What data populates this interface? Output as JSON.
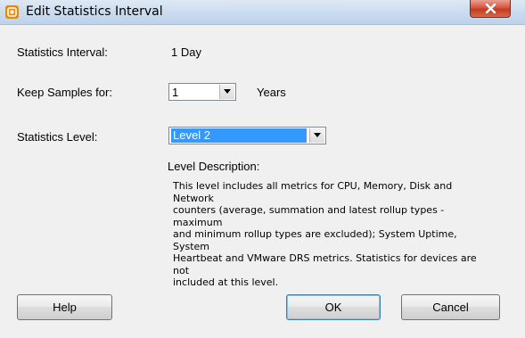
{
  "window": {
    "title": "Edit Statistics Interval"
  },
  "form": {
    "interval_label": "Statistics Interval:",
    "interval_value": "1 Day",
    "keep_label": "Keep Samples for:",
    "keep_value": "1",
    "keep_unit": "Years",
    "level_label": "Statistics Level:",
    "level_value": "Level 2",
    "description_label": "Level Description:",
    "description_lines": [
      "This level includes all metrics for CPU, Memory, Disk and Network",
      "counters (average, summation and latest rollup types - maximum",
      "and minimum rollup types are excluded); System Uptime, System",
      "Heartbeat and VMware DRS metrics. Statistics for devices are not",
      "included at this level."
    ]
  },
  "buttons": {
    "help": "Help",
    "ok": "OK",
    "cancel": "Cancel"
  },
  "icons": {
    "app": "vsphere-logo-icon",
    "close": "close-icon",
    "dropdown": "chevron-down-icon"
  },
  "colors": {
    "selection": "#3399ff",
    "close_button": "#c94a32",
    "titlebar": "#c9dbef"
  }
}
